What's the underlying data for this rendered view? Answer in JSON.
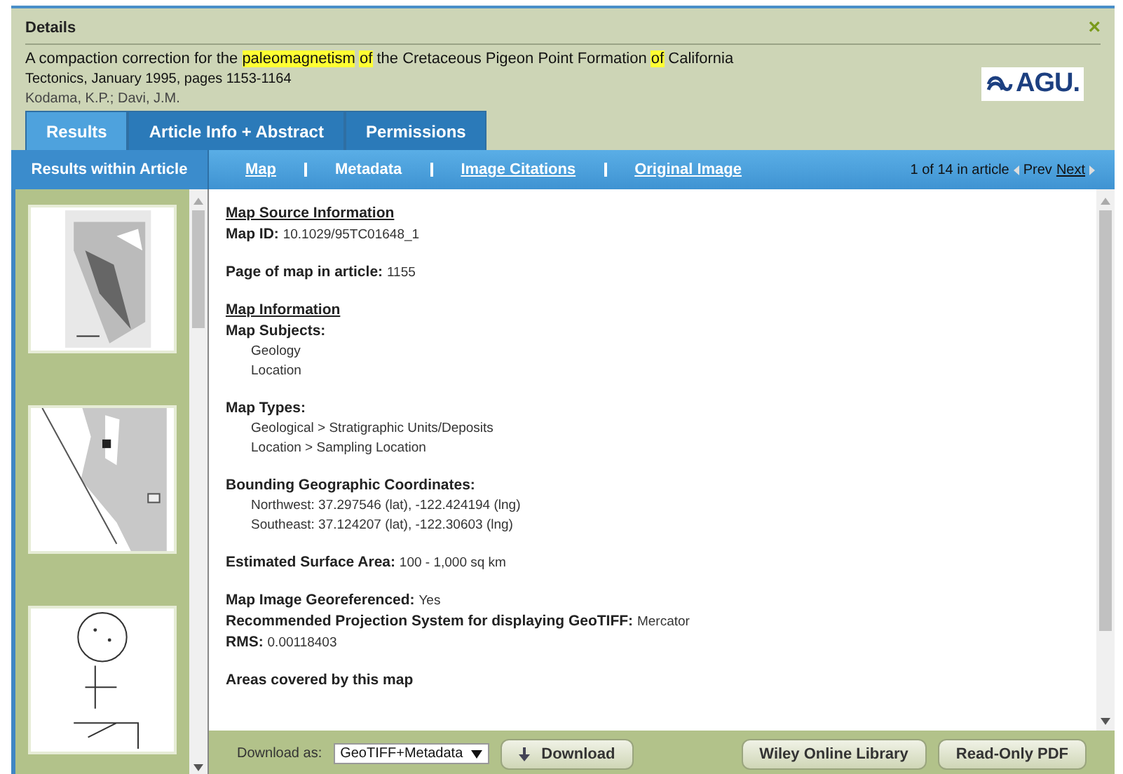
{
  "dialog": {
    "title": "Details",
    "close": "×"
  },
  "article": {
    "title": [
      {
        "text": "A compaction correction for the ",
        "highlighted": false
      },
      {
        "text": "paleomagnetism",
        "highlighted": true
      },
      {
        "text": "of",
        "highlighted": true
      },
      {
        "text": " the Cretaceous Pigeon Point Formation ",
        "highlighted": false
      },
      {
        "text": "of",
        "highlighted": true
      },
      {
        "text": " California",
        "highlighted": false
      }
    ],
    "citation": "Tectonics, January 1995, pages 1153-1164",
    "authors": "Kodama, K.P.; Davi, J.M.",
    "logo": "AGU."
  },
  "tabs": [
    {
      "label": "Results",
      "selected": true
    },
    {
      "label": "Article Info + Abstract",
      "selected": false
    },
    {
      "label": "Permissions",
      "selected": false
    }
  ],
  "sidebar": {
    "title": "Results within Article"
  },
  "views": [
    {
      "label": "Map",
      "selected": false
    },
    {
      "label": "Metadata",
      "selected": true
    },
    {
      "label": "Image Citations",
      "selected": false
    },
    {
      "label": "Original Image",
      "selected": false
    }
  ],
  "pager": {
    "position": "1 of 14 in article",
    "prev": "Prev",
    "next": "Next"
  },
  "content": {
    "blocks": [
      {
        "rows": [
          {
            "kind": "heading",
            "label": "Map Source Information"
          },
          {
            "kind": "field",
            "label": "Map ID:",
            "value": "10.1029/95TC01648_1"
          }
        ]
      },
      {
        "rows": [
          {
            "kind": "field",
            "label": "Page of map in article:",
            "value": "1155"
          }
        ]
      },
      {
        "rows": [
          {
            "kind": "heading",
            "label": "Map Information"
          },
          {
            "kind": "list",
            "label": "Map Subjects:",
            "items": [
              "Geology",
              "Location"
            ]
          }
        ]
      },
      {
        "rows": [
          {
            "kind": "list",
            "label": "Map Types:",
            "items": [
              "Geological > Stratigraphic Units/Deposits",
              "Location > Sampling Location"
            ]
          }
        ]
      },
      {
        "rows": [
          {
            "kind": "list",
            "label": "Bounding Geographic Coordinates:",
            "items": [
              "Northwest: 37.297546 (lat), -122.424194 (lng)",
              "Southeast: 37.124207 (lat), -122.30603 (lng)"
            ]
          }
        ]
      },
      {
        "rows": [
          {
            "kind": "field",
            "label": "Estimated Surface Area:",
            "value": "100 - 1,000 sq km"
          }
        ]
      },
      {
        "rows": [
          {
            "kind": "field",
            "label": "Map Image Georeferenced:",
            "value": "Yes"
          },
          {
            "kind": "field",
            "label": "Recommended Projection System for displaying GeoTIFF:",
            "value": "Mercator"
          },
          {
            "kind": "field",
            "label": "RMS:",
            "value": "0.00118403"
          }
        ]
      },
      {
        "rows": [
          {
            "kind": "list",
            "label": "Areas covered by this map",
            "items": []
          }
        ]
      }
    ]
  },
  "footer": {
    "download_label": "Download as:",
    "format": "GeoTIFF+Metadata",
    "download": "Download",
    "buttons": [
      "Wiley Online Library",
      "Read-Only PDF"
    ]
  }
}
